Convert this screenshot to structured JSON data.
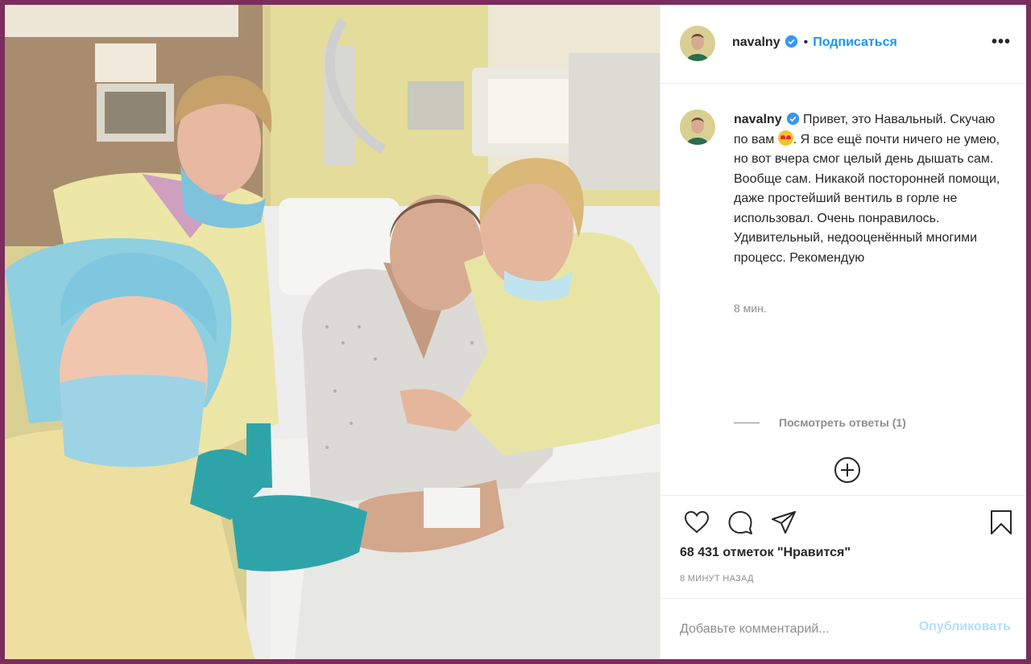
{
  "post": {
    "username": "navalny",
    "follow_label": "Подписаться",
    "more_label": "•••",
    "dot": "•"
  },
  "caption": {
    "username": "navalny",
    "text_part1": "Привет, это Навальный. Скучаю по вам ",
    "emoji_name": "heart-eyes-emoji",
    "text_part2": ". Я все ещё почти ничего не умею, но вот вчера смог целый день дышать сам. Вообще сам. Никакой посторонней помощи, даже простейший вентиль в горле не использовал. Очень понравилось. Удивительный, недооценённый многими процесс. Рекомендую",
    "time": "8 мин."
  },
  "replies": {
    "label": "Посмотреть ответы (1)"
  },
  "stats": {
    "likes": "68 431 отметок \"Нравится\"",
    "posted_ago": "8 МИНУТ НАЗАД"
  },
  "comment": {
    "placeholder": "Добавьте комментарий...",
    "post_label": "Опубликовать"
  },
  "icons": {
    "like": "heart-icon",
    "comment": "speech-bubble-icon",
    "share": "paper-plane-icon",
    "save": "bookmark-icon",
    "load_more": "plus-circle-icon",
    "verified": "verified-badge-icon"
  },
  "colors": {
    "border": "#7b2d5e",
    "link": "#1c97f0",
    "verified": "#3897f0",
    "muted": "#8e8e8e",
    "post_disabled": "#b2dffc"
  }
}
